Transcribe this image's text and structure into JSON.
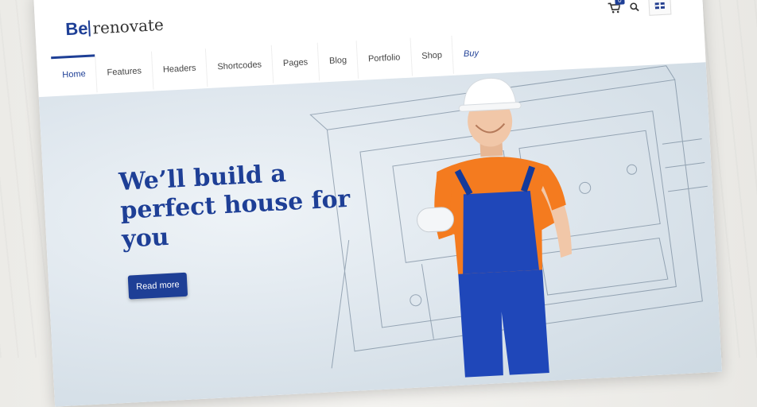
{
  "brand": {
    "prefix": "Be",
    "name": "renovate"
  },
  "nav": {
    "items": [
      {
        "label": "Home",
        "active": true
      },
      {
        "label": "Features"
      },
      {
        "label": "Headers"
      },
      {
        "label": "Shortcodes"
      },
      {
        "label": "Pages"
      },
      {
        "label": "Blog"
      },
      {
        "label": "Portfolio"
      },
      {
        "label": "Shop"
      },
      {
        "label": "Buy"
      }
    ]
  },
  "header_tools": {
    "cart_count": "0",
    "cart_icon": "shopping-cart-icon",
    "search_icon": "search-icon",
    "language_icon": "uk-flag-icon"
  },
  "hero": {
    "headline": "We’ll build a perfect house for you",
    "cta_label": "Read more"
  },
  "colors": {
    "brand": "#1e3f96",
    "hero_bg": "#dfe7ee",
    "worker_shirt": "#f47b1f",
    "worker_overalls": "#1f47b9"
  }
}
